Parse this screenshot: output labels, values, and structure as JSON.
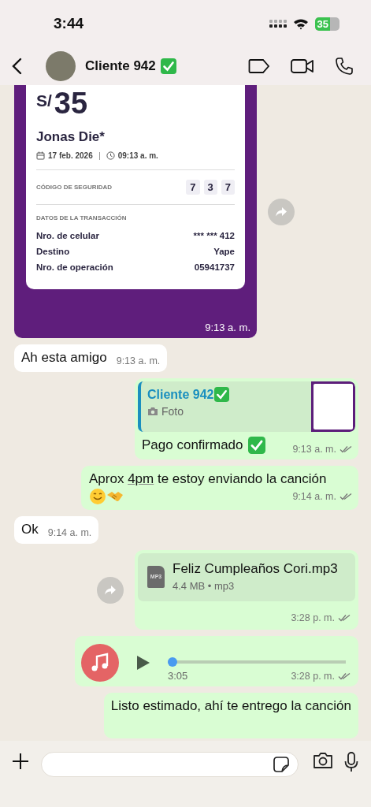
{
  "status_bar": {
    "time": "3:44",
    "battery": "35"
  },
  "header": {
    "title": "Cliente 942"
  },
  "messages": [
    {
      "kind": "receipt",
      "outgoing": false,
      "forwardable": true,
      "currency": "S/",
      "amount": "35",
      "name": "Jonas Die*",
      "date": "17 feb. 2026",
      "time": "09:13 a. m.",
      "security_label": "CÓDIGO DE SEGURIDAD",
      "security_code": [
        "7",
        "3",
        "7"
      ],
      "details_label": "DATOS DE LA TRANSACCIÓN",
      "details": [
        {
          "label": "Nro. de celular",
          "value": "*** *** 412"
        },
        {
          "label": "Destino",
          "value": "Yape"
        },
        {
          "label": "Nro. de operación",
          "value": "05941737"
        }
      ],
      "timestamp": "9:13 a. m."
    },
    {
      "kind": "text",
      "outgoing": false,
      "text": "Ah esta amigo",
      "timestamp": "9:13 a. m."
    },
    {
      "kind": "reply",
      "outgoing": true,
      "quoted_author": "Cliente 942",
      "quoted_type": "Foto",
      "text": "Pago confirmado",
      "timestamp": "9:13 a. m."
    },
    {
      "kind": "link_text",
      "outgoing": true,
      "before": "Aprox",
      "link": "4pm",
      "after": "te estoy enviando la canción",
      "timestamp": "9:14 a. m."
    },
    {
      "kind": "text",
      "outgoing": false,
      "text": "Ok",
      "timestamp": "9:14 a. m."
    },
    {
      "kind": "file",
      "outgoing": true,
      "forwardable": true,
      "file_type": "MP3",
      "file_name": "Feliz Cumpleaños Cori.mp3",
      "file_info": "4.4 MB • mp3",
      "timestamp": "3:28 p. m."
    },
    {
      "kind": "audio",
      "outgoing": true,
      "level": 0,
      "duration": "3:05",
      "timestamp": "3:28 p. m."
    },
    {
      "kind": "text",
      "outgoing": true,
      "cut": true,
      "text": "Listo estimado, ahí te entrego la canción"
    }
  ]
}
